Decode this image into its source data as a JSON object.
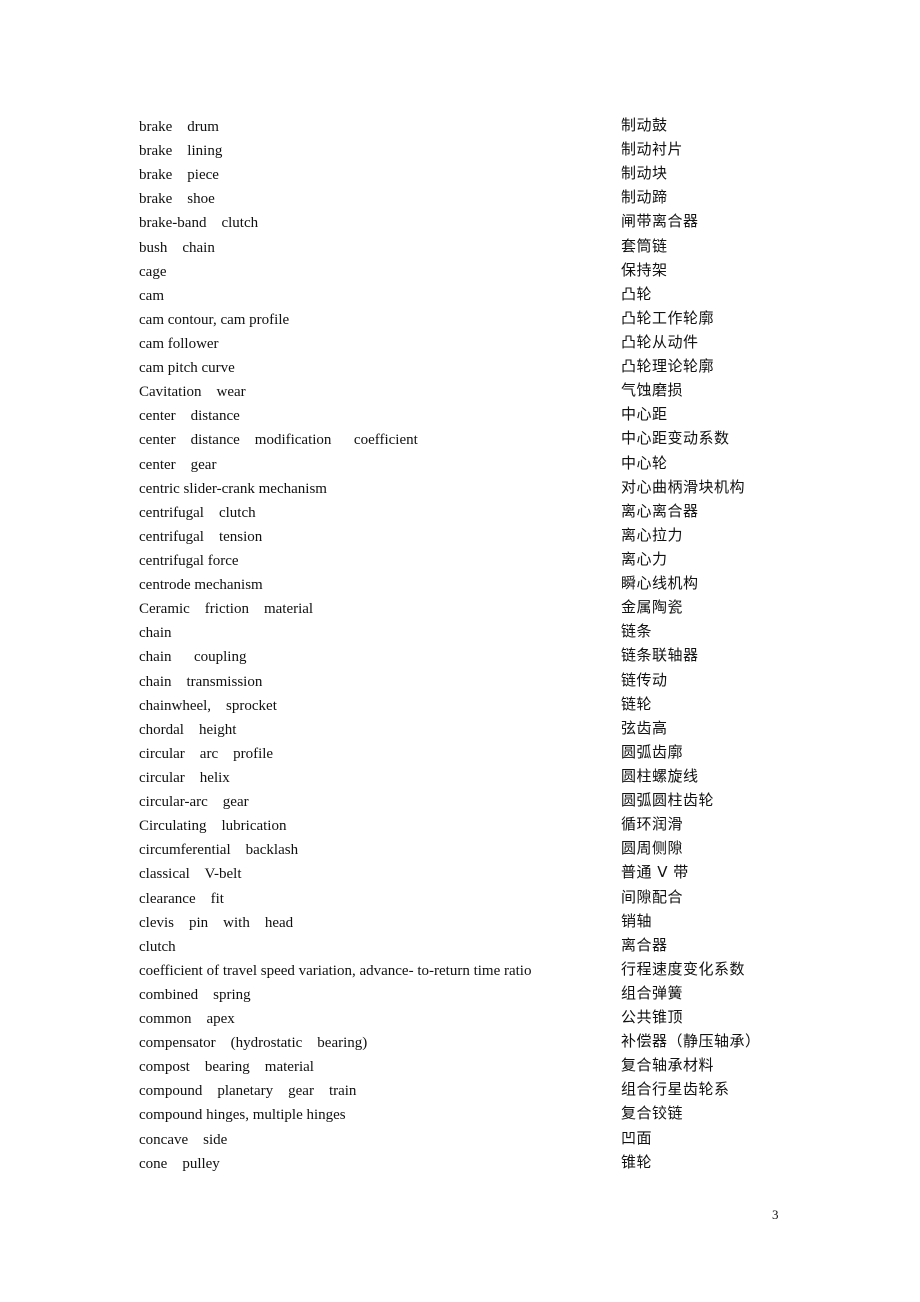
{
  "document": {
    "page_number": "3",
    "entries": [
      {
        "en": "brake    drum",
        "zh": "制动鼓"
      },
      {
        "en": "brake    lining",
        "zh": "制动衬片"
      },
      {
        "en": "brake    piece",
        "zh": "制动块"
      },
      {
        "en": "brake    shoe",
        "zh": "制动蹄"
      },
      {
        "en": "brake-band    clutch",
        "zh": "闸带离合器"
      },
      {
        "en": "bush    chain",
        "zh": "套筒链"
      },
      {
        "en": "cage",
        "zh": "保持架"
      },
      {
        "en": "cam",
        "zh": "凸轮"
      },
      {
        "en": "cam contour, cam profile",
        "zh": "凸轮工作轮廓"
      },
      {
        "en": "cam follower",
        "zh": "凸轮从动件"
      },
      {
        "en": "cam pitch curve",
        "zh": "凸轮理论轮廓"
      },
      {
        "en": "Cavitation    wear",
        "zh": "气蚀磨损"
      },
      {
        "en": "center    distance",
        "zh": "中心距"
      },
      {
        "en": "center    distance    modification      coefficient",
        "zh": "中心距变动系数"
      },
      {
        "en": "center    gear",
        "zh": "中心轮"
      },
      {
        "en": "centric slider-crank mechanism",
        "zh": "对心曲柄滑块机构"
      },
      {
        "en": "centrifugal    clutch",
        "zh": "离心离合器"
      },
      {
        "en": "centrifugal    tension",
        "zh": "离心拉力"
      },
      {
        "en": "centrifugal force",
        "zh": "离心力"
      },
      {
        "en": "centrode mechanism",
        "zh": "瞬心线机构"
      },
      {
        "en": "Ceramic    friction    material",
        "zh": "金属陶瓷"
      },
      {
        "en": "chain",
        "zh": "链条"
      },
      {
        "en": "chain      coupling",
        "zh": "链条联轴器"
      },
      {
        "en": "chain    transmission",
        "zh": "链传动"
      },
      {
        "en": "chainwheel,    sprocket",
        "zh": "链轮"
      },
      {
        "en": "chordal    height",
        "zh": "弦齿高"
      },
      {
        "en": "circular    arc    profile",
        "zh": "圆弧齿廓"
      },
      {
        "en": "circular    helix",
        "zh": "圆柱螺旋线"
      },
      {
        "en": "circular-arc    gear",
        "zh": "圆弧圆柱齿轮"
      },
      {
        "en": "Circulating    lubrication",
        "zh": "循环润滑"
      },
      {
        "en": "circumferential    backlash",
        "zh": "圆周侧隙"
      },
      {
        "en": "classical    V-belt",
        "zh": "普通 V 带"
      },
      {
        "en": "clearance    fit",
        "zh": "间隙配合"
      },
      {
        "en": "clevis    pin    with    head",
        "zh": "销轴"
      },
      {
        "en": "clutch",
        "zh": "离合器"
      },
      {
        "en": "coefficient of travel speed variation, advance- to-return time ratio",
        "zh": "行程速度变化系数"
      },
      {
        "en": "combined    spring",
        "zh": "组合弹簧"
      },
      {
        "en": "common    apex",
        "zh": "公共锥顶"
      },
      {
        "en": "compensator    (hydrostatic    bearing)",
        "zh": "补偿器（静压轴承）"
      },
      {
        "en": "compost    bearing    material",
        "zh": "复合轴承材料"
      },
      {
        "en": "compound    planetary    gear    train",
        "zh": "组合行星齿轮系"
      },
      {
        "en": "compound hinges, multiple hinges",
        "zh": "复合铰链"
      },
      {
        "en": "concave    side",
        "zh": "凹面"
      },
      {
        "en": "cone    pulley",
        "zh": "锥轮"
      }
    ]
  }
}
